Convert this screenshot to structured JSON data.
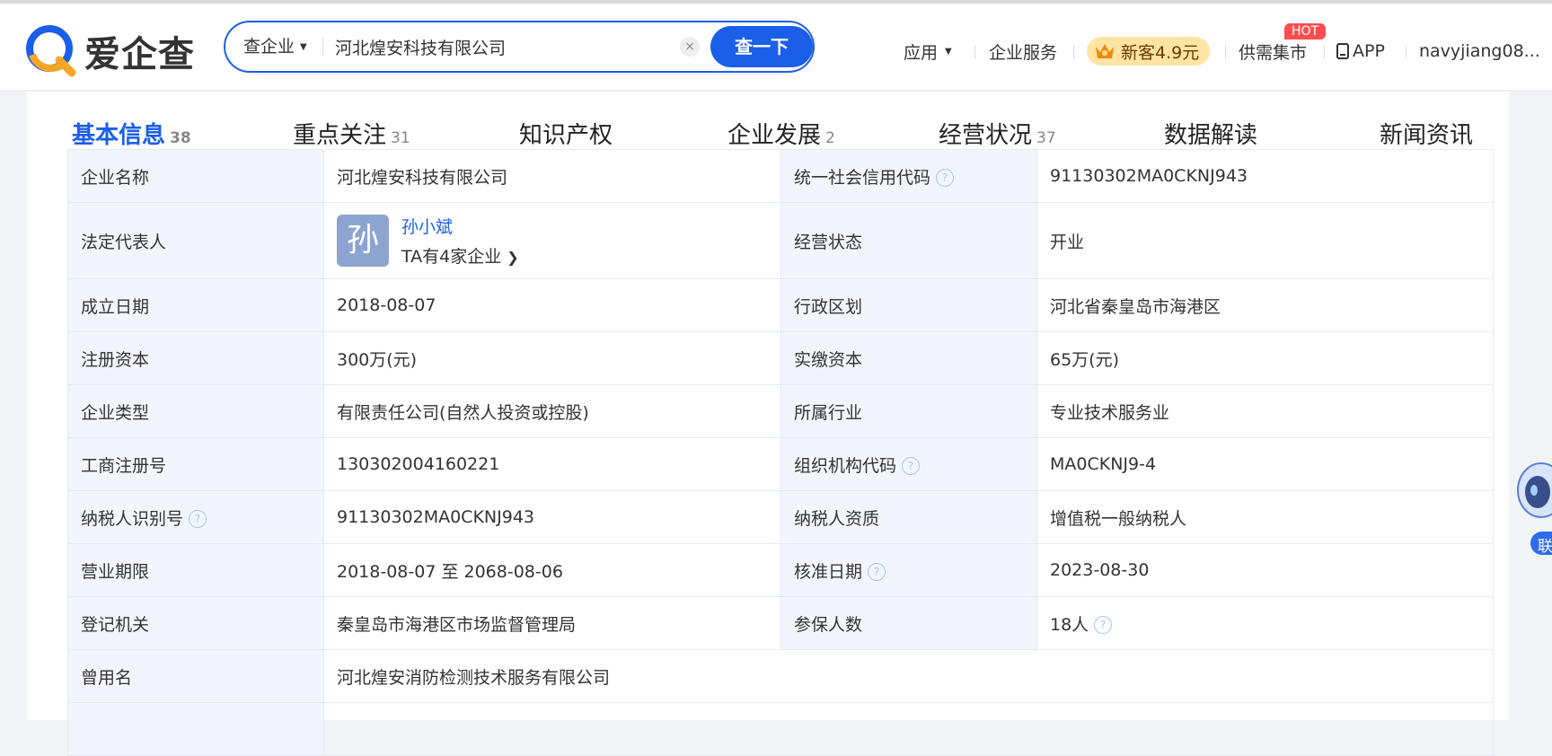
{
  "header": {
    "logo_text": "爱企查",
    "search": {
      "type_label": "查企业",
      "value": "河北煌安科技有限公司",
      "clear_glyph": "×",
      "button_label": "查一下"
    },
    "nav": {
      "apps": "应用",
      "services": "企业服务",
      "promo": "新客4.9元",
      "hot_badge": "HOT",
      "market": "供需集市",
      "app": "APP",
      "user": "navyjiang08..."
    }
  },
  "tabs": [
    {
      "label": "基本信息",
      "count": "38"
    },
    {
      "label": "重点关注",
      "count": "31"
    },
    {
      "label": "知识产权",
      "count": ""
    },
    {
      "label": "企业发展",
      "count": "2"
    },
    {
      "label": "经营状况",
      "count": "37"
    },
    {
      "label": "数据解读",
      "count": ""
    },
    {
      "label": "新闻资讯",
      "count": ""
    }
  ],
  "info": {
    "company_name_label": "企业名称",
    "company_name": "河北煌安科技有限公司",
    "credit_code_label": "统一社会信用代码",
    "credit_code": "91130302MA0CKNJ943",
    "legal_rep_label": "法定代表人",
    "legal_rep_avatar": "孙",
    "legal_rep_name": "孙小斌",
    "legal_rep_sub": "TA有4家企业",
    "status_label": "经营状态",
    "status": "开业",
    "founded_label": "成立日期",
    "founded": "2018-08-07",
    "region_label": "行政区划",
    "region": "河北省秦皇岛市海港区",
    "reg_capital_label": "注册资本",
    "reg_capital": "300万(元)",
    "paid_capital_label": "实缴资本",
    "paid_capital": "65万(元)",
    "type_label": "企业类型",
    "type": "有限责任公司(自然人投资或控股)",
    "industry_label": "所属行业",
    "industry": "专业技术服务业",
    "reg_no_label": "工商注册号",
    "reg_no": "130302004160221",
    "org_code_label": "组织机构代码",
    "org_code": "MA0CKNJ9-4",
    "taxpayer_id_label": "纳税人识别号",
    "taxpayer_id": "91130302MA0CKNJ943",
    "taxpayer_qual_label": "纳税人资质",
    "taxpayer_qual": "增值税一般纳税人",
    "term_label": "营业期限",
    "term": "2018-08-07 至 2068-08-06",
    "approve_date_label": "核准日期",
    "approve_date": "2023-08-30",
    "authority_label": "登记机关",
    "authority": "秦皇岛市海港区市场监督管理局",
    "insured_label": "参保人数",
    "insured": "18人",
    "former_name_label": "曾用名",
    "former_name": "河北煌安消防检测技术服务有限公司"
  },
  "assistant_label": "联",
  "colors": {
    "brand_blue": "#1b5fe8",
    "label_bg": "#f2f6fc",
    "promo_bg": "#ffe4a3",
    "hot_red": "#ff4d4f"
  }
}
